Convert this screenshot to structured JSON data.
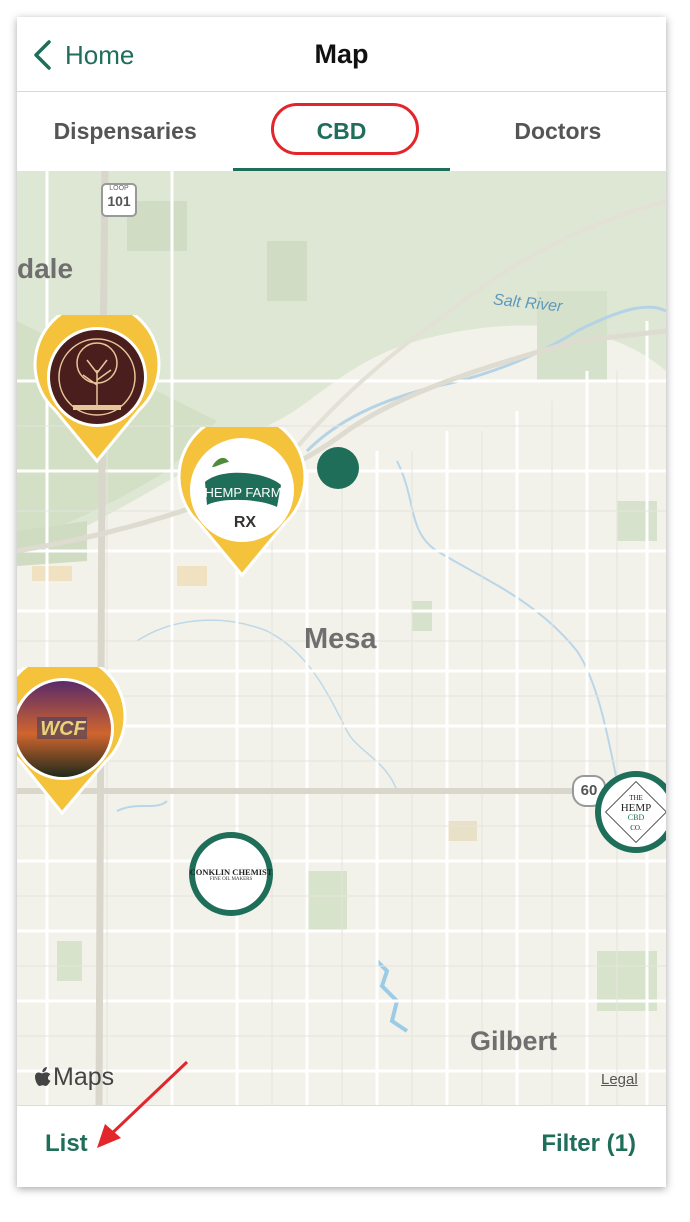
{
  "header": {
    "back_label": "Home",
    "title": "Map"
  },
  "tabs": [
    {
      "label": "Dispensaries",
      "active": false
    },
    {
      "label": "CBD",
      "active": true
    },
    {
      "label": "Doctors",
      "active": false
    }
  ],
  "map": {
    "labels": {
      "city1": "dale",
      "city2": "Mesa",
      "city3": "Gilbert",
      "river": "Salt River",
      "shield1": "101",
      "shield1_top": "LOOP",
      "shield2": "60"
    },
    "attribution": "Maps",
    "legal": "Legal",
    "pins": {
      "hemp_farm_line1": "HEMP FARM",
      "hemp_farm_line2": "RX",
      "wcf": "WCF",
      "conklin_line1": "CONKLIN CHEMIST",
      "conklin_line2": "FINE OIL MAKERS",
      "hemp_co_line1": "THE",
      "hemp_co_line2": "HEMP",
      "hemp_co_line3": "CBD",
      "hemp_co_line4": "CO."
    }
  },
  "bottom": {
    "list_label": "List",
    "filter_label": "Filter (1)"
  },
  "colors": {
    "accent": "#1f6e5a",
    "pin_gold": "#f4c33b",
    "highlight": "#e2262b"
  }
}
